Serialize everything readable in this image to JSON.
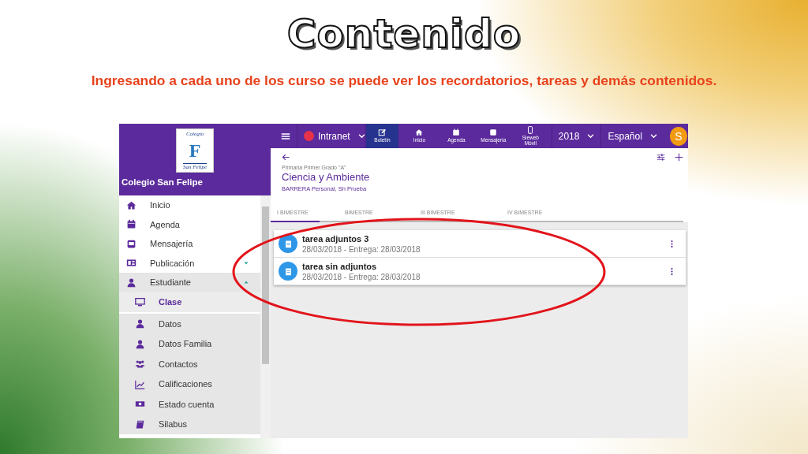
{
  "slide": {
    "title": "Contenido",
    "subtitle": "Ingresando a cada uno de los curso se puede ver los recordatorios, tareas y demás contenidos."
  },
  "sidebar": {
    "logo": {
      "arc_text": "Colegio",
      "monogram": "F",
      "motto": "San Felipe"
    },
    "school_name": "Colegio San Felipe",
    "items": [
      {
        "label": "Inicio"
      },
      {
        "label": "Agenda"
      },
      {
        "label": "Mensajería"
      },
      {
        "label": "Publicación",
        "expanded": false
      },
      {
        "label": "Estudiante",
        "expanded": true,
        "children": [
          {
            "label": "Clase",
            "selected": true
          },
          {
            "label": "Datos",
            "selected": false
          },
          {
            "label": "Datos Familia",
            "selected": false
          },
          {
            "label": "Contactos",
            "selected": false
          },
          {
            "label": "Calificaciones",
            "selected": false
          },
          {
            "label": "Estado cuenta",
            "selected": false
          },
          {
            "label": "Silabus",
            "selected": false
          }
        ]
      }
    ]
  },
  "top_bar": {
    "site": "Intranet",
    "nav": [
      {
        "label": "Boletín",
        "selected": true
      },
      {
        "label": "Inicio",
        "selected": false
      },
      {
        "label": "Agenda",
        "selected": false
      },
      {
        "label": "Mensajería",
        "selected": false
      },
      {
        "label": "Sieweb Móvil",
        "selected": false
      }
    ],
    "year": "2018",
    "language": "Español",
    "avatar": "S"
  },
  "course": {
    "level": "Primaria Primer Grado \"A\"",
    "title": "Ciencia y Ambiente",
    "teacher": "BARRERA Personal, Sh Prueba",
    "tabs": [
      {
        "label": "I BIMESTRE",
        "selected": true
      },
      {
        "label": "BIMESTRE",
        "selected": false
      },
      {
        "label": "III BIMESTRE",
        "selected": false
      },
      {
        "label": "IV BIMESTRE",
        "selected": false
      }
    ],
    "tasks": [
      {
        "title": "tarea adjuntos 3",
        "dates": "28/03/2018 - Entrega: 28/03/2018"
      },
      {
        "title": "tarea sin adjuntos",
        "dates": "28/03/2018 - Entrega: 28/03/2018"
      }
    ]
  }
}
